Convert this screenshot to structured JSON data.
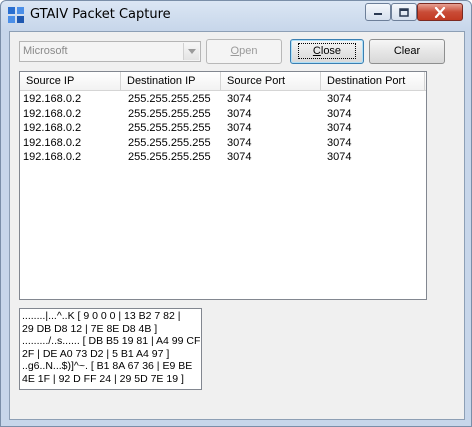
{
  "window": {
    "title": "GTAIV Packet Capture"
  },
  "controls": {
    "device_combo_value": "Microsoft",
    "open_label_first": "O",
    "open_label_rest": "pen",
    "close_label_first": "C",
    "close_label_rest": "lose",
    "clear_label": "Clear"
  },
  "packet_list": {
    "columns": [
      "Source IP",
      "Destination IP",
      "Source Port",
      "Destination Port"
    ],
    "rows": [
      [
        "192.168.0.2",
        "255.255.255.255",
        "3074",
        "3074"
      ],
      [
        "192.168.0.2",
        "255.255.255.255",
        "3074",
        "3074"
      ],
      [
        "192.168.0.2",
        "255.255.255.255",
        "3074",
        "3074"
      ],
      [
        "192.168.0.2",
        "255.255.255.255",
        "3074",
        "3074"
      ],
      [
        "192.168.0.2",
        "255.255.255.255",
        "3074",
        "3074"
      ]
    ]
  },
  "hex_dump": {
    "lines": [
      "........|...^..K [  9  0  0  0 | 13 B2  7 82 |",
      "29 DB D8 12 | 7E 8E D8 4B ]",
      "........./..s...... [ DB B5 19 81 | A4 99 CF",
      "2F | DE A0 73 D2 |  5 B1 A4 97 ]",
      "..g6..N...$)]^~. [ B1 8A 67 36 | E9 BE",
      "4E 1F | 92  D FF 24 | 29 5D 7E 19 ]"
    ]
  }
}
